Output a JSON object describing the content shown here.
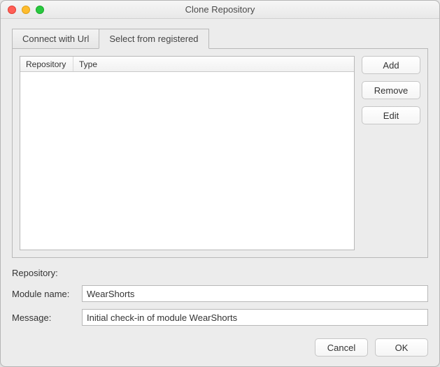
{
  "window": {
    "title": "Clone Repository"
  },
  "tabs": {
    "connect": "Connect with Url",
    "select": "Select from registered"
  },
  "list": {
    "col_repository": "Repository",
    "col_type": "Type"
  },
  "buttons": {
    "add": "Add",
    "remove": "Remove",
    "edit": "Edit",
    "cancel": "Cancel",
    "ok": "OK"
  },
  "form": {
    "repository_label": "Repository:",
    "repository_value": "",
    "module_label": "Module name:",
    "module_value": "WearShorts",
    "message_label": "Message:",
    "message_value": "Initial check-in of module WearShorts"
  }
}
